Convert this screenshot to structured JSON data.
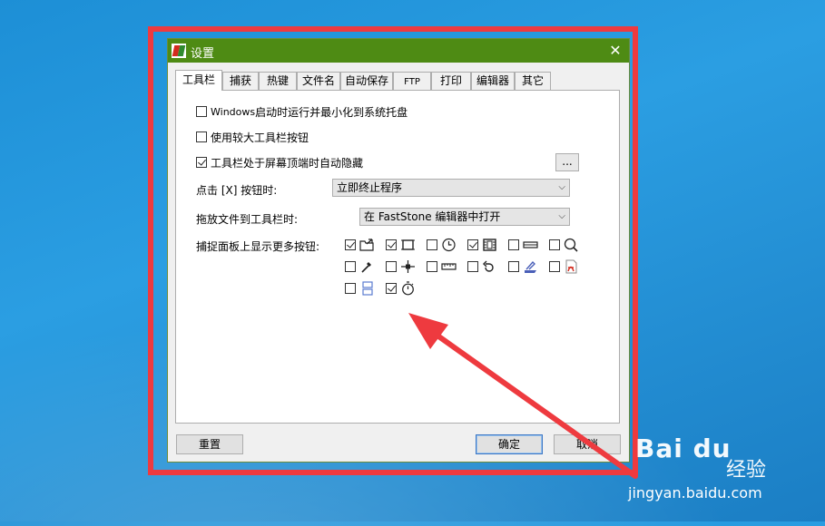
{
  "window": {
    "title": "设置",
    "close_glyph": "✕"
  },
  "tabs": [
    {
      "label": "工具栏",
      "active": true
    },
    {
      "label": "捕获"
    },
    {
      "label": "热键"
    },
    {
      "label": "文件名"
    },
    {
      "label": "自动保存"
    },
    {
      "label": "FTP"
    },
    {
      "label": "打印"
    },
    {
      "label": "编辑器"
    },
    {
      "label": "其它"
    }
  ],
  "toolbar_tab": {
    "opt_startup_prefix": "Windows",
    "opt_startup_text": " 启动时运行并最小化到系统托盘",
    "opt_startup_checked": false,
    "opt_large_buttons": "使用较大工具栏按钮",
    "opt_large_checked": false,
    "opt_autohide": "工具栏处于屏幕顶端时自动隐藏",
    "opt_autohide_checked": true,
    "ellipsis_label": "...",
    "close_action_label": "点击 [X] 按钮时:",
    "close_action_value": "立即终止程序",
    "drop_label": "拖放文件到工具栏时:",
    "drop_value": "在 FastStone 编辑器中打开",
    "more_buttons_label": "捕捉面板上显示更多按钮:",
    "capture_buttons": [
      {
        "icon": "open-folder-icon",
        "checked": true
      },
      {
        "icon": "crop-region-icon",
        "checked": true
      },
      {
        "icon": "clock-icon",
        "checked": false
      },
      {
        "icon": "film-icon",
        "checked": true
      },
      {
        "icon": "scroll-bar-icon",
        "checked": false
      },
      {
        "icon": "magnifier-icon",
        "checked": false
      },
      {
        "icon": "color-picker-icon",
        "checked": false
      },
      {
        "icon": "crosshair-icon",
        "checked": false
      },
      {
        "icon": "ruler-icon",
        "checked": false
      },
      {
        "icon": "redo-arrow-icon",
        "checked": false
      },
      {
        "icon": "scanner-icon",
        "checked": false
      },
      {
        "icon": "pdf-icon",
        "checked": false
      },
      {
        "icon": "split-screen-icon",
        "checked": false
      },
      {
        "icon": "stopwatch-icon",
        "checked": true
      }
    ]
  },
  "footer": {
    "reset_label": "重置",
    "ok_label": "确定",
    "cancel_label": "取消"
  },
  "watermark": {
    "brand": "Bai du",
    "brand_cn": "经验",
    "url": "jingyan.baidu.com"
  },
  "colors": {
    "titlebar": "#4e8b14",
    "annotation_red": "#ee3a3f"
  }
}
